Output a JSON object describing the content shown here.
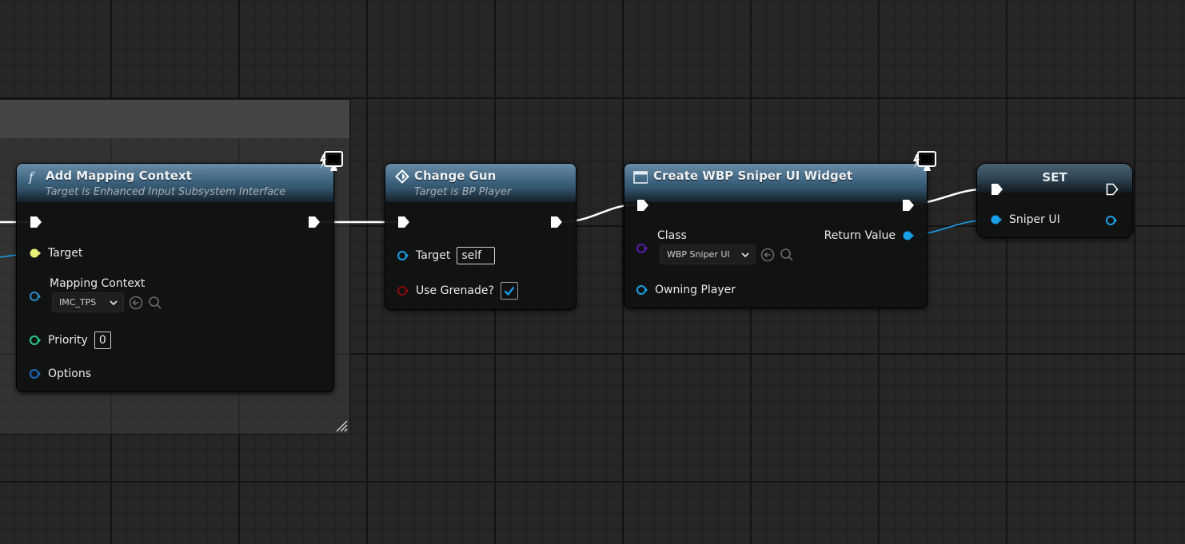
{
  "nodes": {
    "add_mapping_context": {
      "title": "Add Mapping Context",
      "subtitle": "Target is Enhanced Input Subsystem Interface",
      "icon": "function-icon",
      "pins": {
        "target": "Target",
        "mapping_context": "Mapping Context",
        "mapping_context_value": "IMC_TPS",
        "priority": "Priority",
        "priority_value": "0",
        "options": "Options"
      }
    },
    "change_gun": {
      "title": "Change Gun",
      "subtitle": "Target is BP Player",
      "icon": "event-diamond-icon",
      "pins": {
        "target": "Target",
        "target_value": "self",
        "use_grenade": "Use Grenade?",
        "use_grenade_checked": true
      }
    },
    "create_widget": {
      "title": "Create WBP Sniper UI Widget",
      "icon": "widget-icon",
      "pins": {
        "class": "Class",
        "class_value": "WBP Sniper UI",
        "owning_player": "Owning Player",
        "return_value": "Return Value"
      }
    },
    "set": {
      "title": "SET",
      "pins": {
        "sniper_ui": "Sniper UI"
      }
    }
  },
  "colors": {
    "exec_pin": "#ffffff",
    "target_pin_yellow": "#e8f07a",
    "object_pin_blue": "#18a0e8",
    "mapping_pin": "#2a8ac8",
    "int_pin_green": "#2ac88a",
    "struct_pin": "#1a6ab8",
    "bool_pin_red": "#8a0a0a",
    "class_pin_purple": "#5a1aa8",
    "checkbox_check": "#1a9ae8",
    "header_blue": "#3e6480"
  }
}
